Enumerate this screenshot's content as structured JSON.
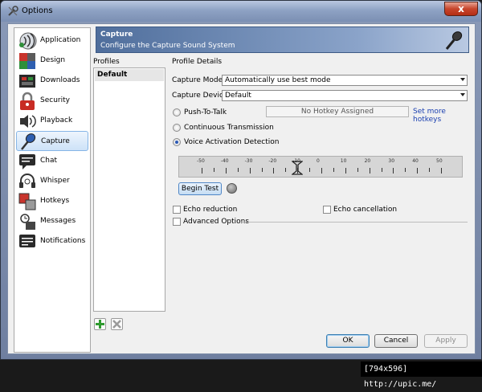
{
  "window": {
    "title": "Options",
    "close_label": "x"
  },
  "sidebar": {
    "items": [
      {
        "label": "Application",
        "icon": "application-icon"
      },
      {
        "label": "Design",
        "icon": "design-icon"
      },
      {
        "label": "Downloads",
        "icon": "downloads-icon"
      },
      {
        "label": "Security",
        "icon": "security-icon"
      },
      {
        "label": "Playback",
        "icon": "playback-icon"
      },
      {
        "label": "Capture",
        "icon": "capture-icon",
        "selected": true
      },
      {
        "label": "Chat",
        "icon": "chat-icon"
      },
      {
        "label": "Whisper",
        "icon": "whisper-icon"
      },
      {
        "label": "Hotkeys",
        "icon": "hotkeys-icon"
      },
      {
        "label": "Messages",
        "icon": "messages-icon"
      },
      {
        "label": "Notifications",
        "icon": "notifications-icon"
      }
    ]
  },
  "banner": {
    "title": "Capture",
    "subtitle": "Configure the Capture Sound System"
  },
  "profiles": {
    "label": "Profiles",
    "items": [
      "Default"
    ]
  },
  "details": {
    "label": "Profile Details",
    "capture_mode_label": "Capture Mode:",
    "capture_mode_value": "Automatically use best mode",
    "capture_device_label": "Capture Device:",
    "capture_device_value": "Default",
    "push_to_talk": "Push-To-Talk",
    "hotkey_placeholder": "No Hotkey Assigned",
    "set_hotkeys": "Set more hotkeys",
    "continuous": "Continuous Transmission",
    "voice_activation": "Voice Activation Detection",
    "selected_mode": "voice_activation",
    "slider_ticks": [
      "-50",
      "-40",
      "-30",
      "-20",
      "-10",
      "0",
      "10",
      "20",
      "30",
      "40",
      "50"
    ],
    "slider_value": -10,
    "begin_test": "Begin Test",
    "echo_reduction": "Echo reduction",
    "echo_cancellation": "Echo cancellation",
    "advanced_options": "Advanced Options"
  },
  "buttons": {
    "ok": "OK",
    "cancel": "Cancel",
    "apply": "Apply"
  },
  "footer": {
    "text": "[794x596] http://upic.me/"
  }
}
